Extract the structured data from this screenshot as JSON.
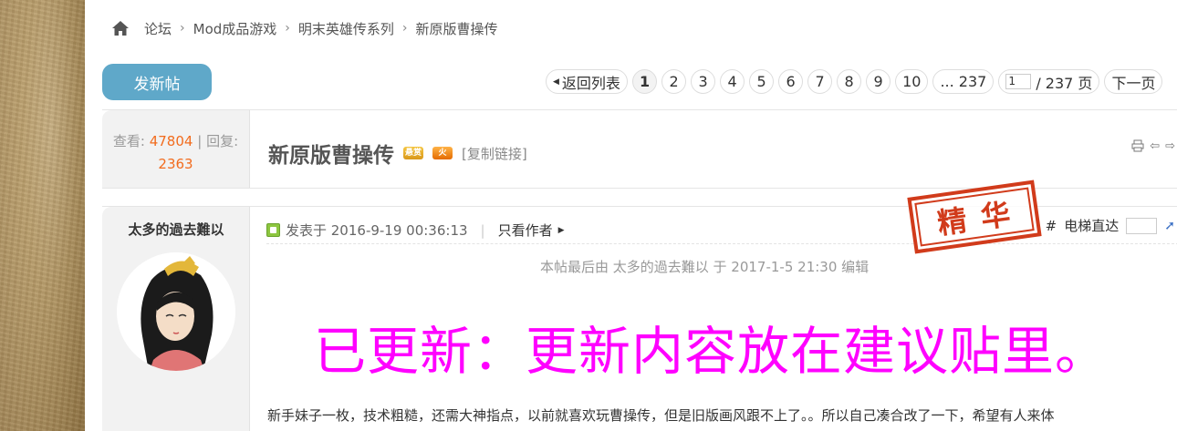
{
  "breadcrumb": {
    "items": [
      "论坛",
      "Mod成品游戏",
      "明末英雄传系列",
      "新原版曹操传"
    ]
  },
  "toolbar": {
    "new_post_label": "发新帖"
  },
  "pager": {
    "back_label": "返回列表",
    "pages": [
      "1",
      "2",
      "3",
      "4",
      "5",
      "6",
      "7",
      "8",
      "9",
      "10"
    ],
    "current_page": "1",
    "last_label": "... 237",
    "jump_value": "1",
    "total_label": "/ 237 页",
    "next_label": "下一页"
  },
  "thread": {
    "views_label": "查看:",
    "views": "47804",
    "replies_label": "回复:",
    "replies": "2363",
    "title": "新原版曹操传",
    "reward_badge": "悬赏",
    "hot_badge": "火",
    "copy_link": "[复制链接]"
  },
  "post": {
    "author": "太多的過去難以",
    "posted_at": "发表于 2016-9-19 00:36:13",
    "only_author": "只看作者",
    "floor_mark": "#",
    "floor_jump_label": "电梯直达",
    "stamp": "精华",
    "edit_note": "本帖最后由 太多的過去難以 于 2017-1-5 21:30 编辑",
    "notice": "已更新：更新内容放在建议贴里。",
    "body": "新手妹子一枚，技术粗糙，还需大神指点，以前就喜欢玩曹操传，但是旧版画风跟不上了。。所以自己凑合改了一下，希望有人来体"
  },
  "colors": {
    "accent_button": "#5fa8c9",
    "stat_number": "#f26c1e",
    "notice": "#ff00ff",
    "stamp": "#d13b1b"
  }
}
